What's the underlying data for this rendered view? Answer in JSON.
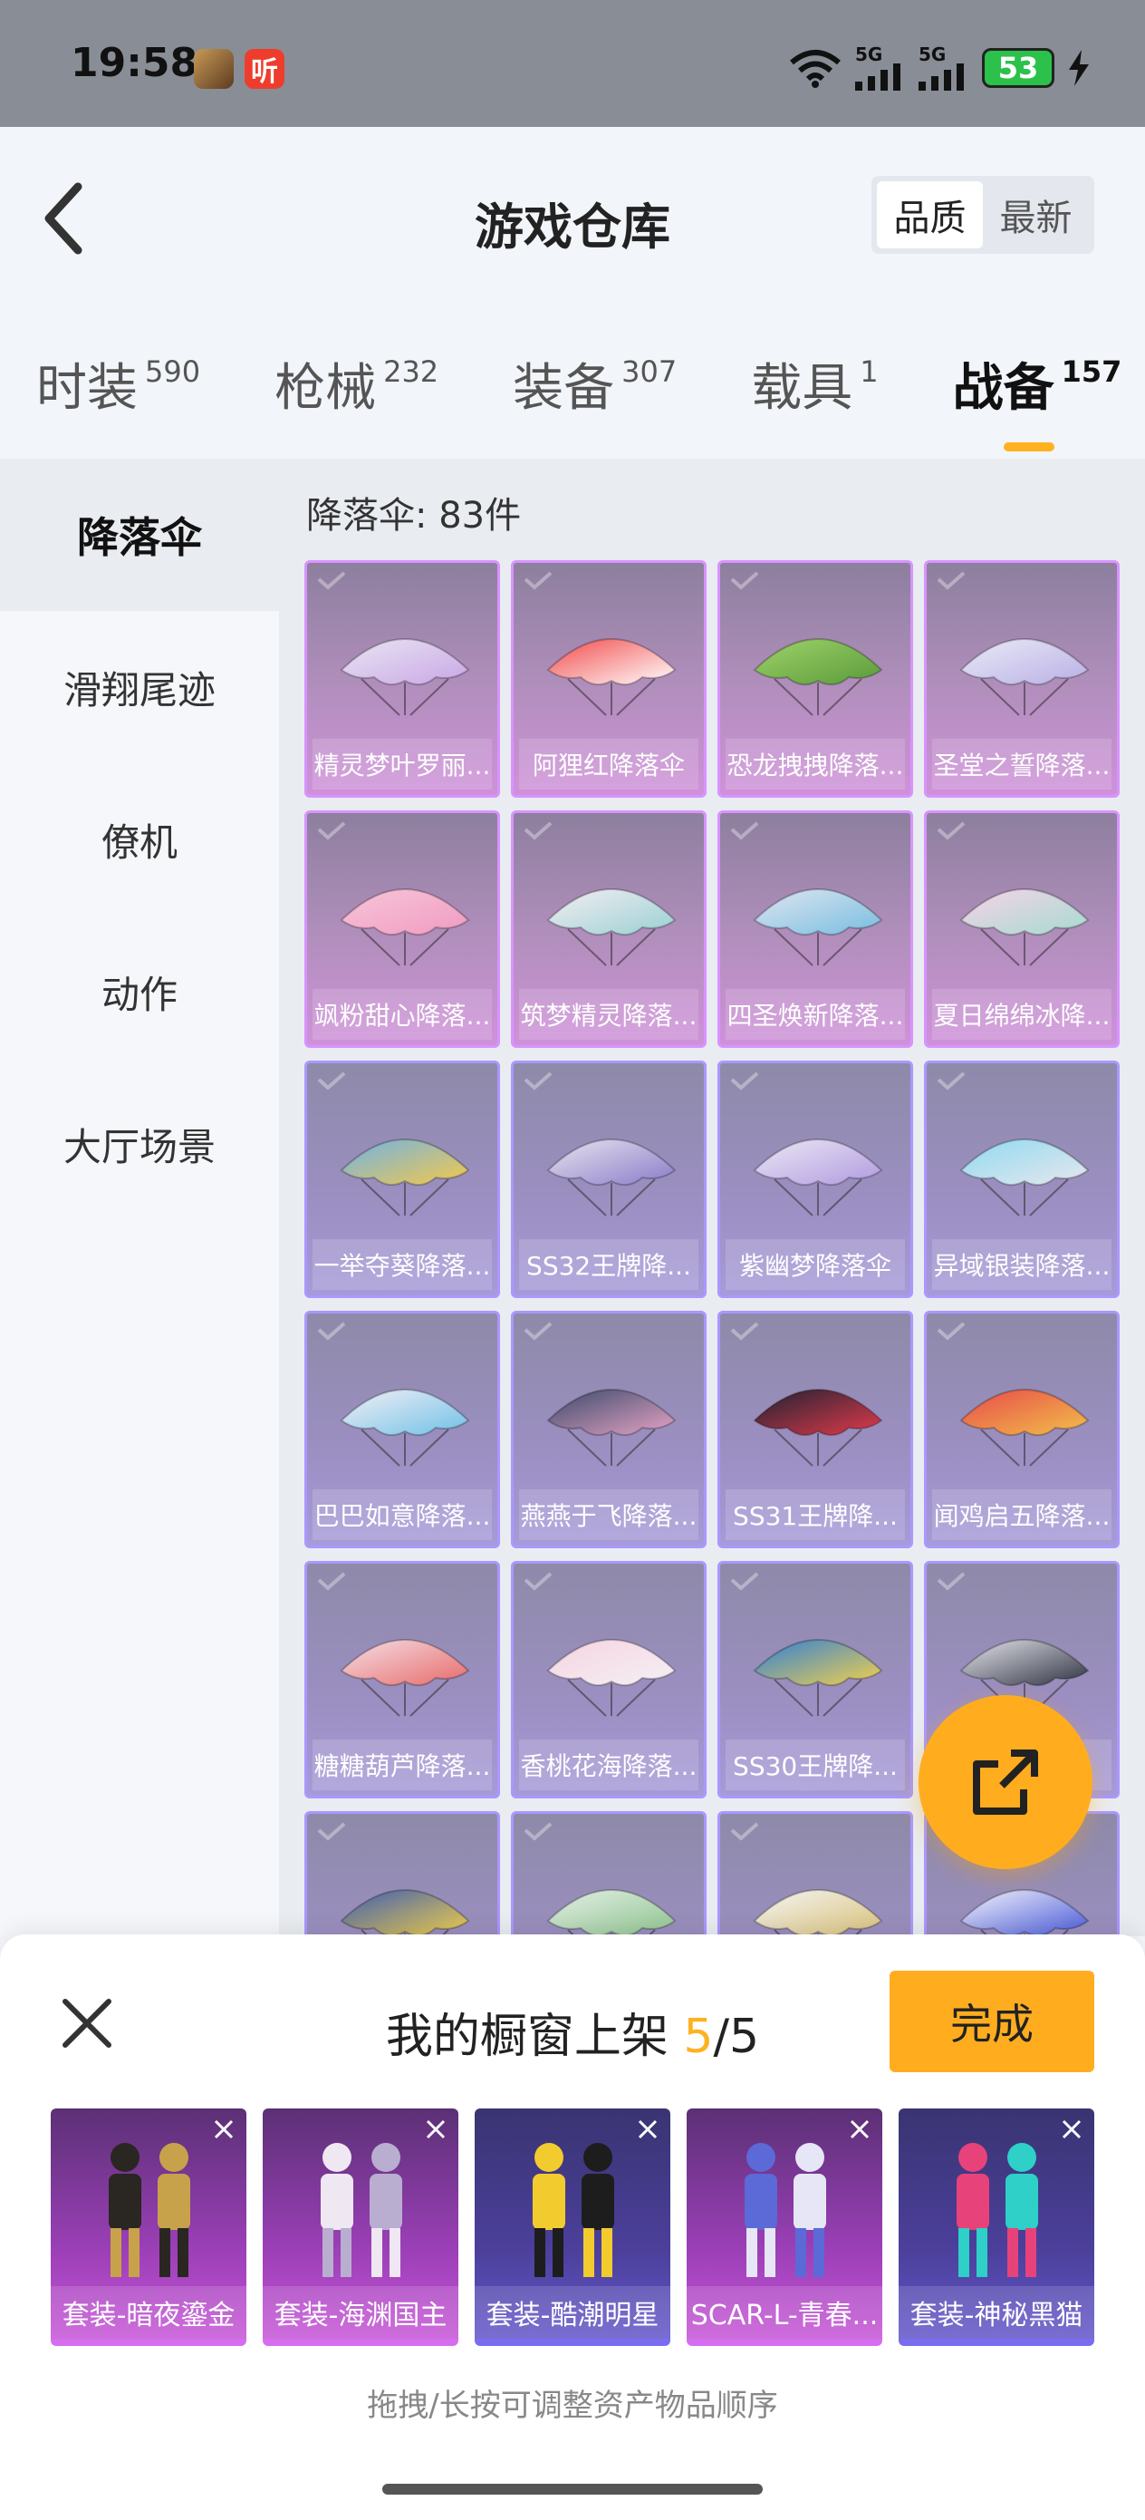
{
  "status": {
    "time": "19:58",
    "ting": "听",
    "network1": "5G",
    "network2": "5G",
    "battery": "53"
  },
  "header": {
    "title": "游戏仓库",
    "sort": [
      "品质",
      "最新"
    ]
  },
  "categories": [
    {
      "label": "时装",
      "count": "590"
    },
    {
      "label": "枪械",
      "count": "232"
    },
    {
      "label": "装备",
      "count": "307"
    },
    {
      "label": "载具",
      "count": "1"
    },
    {
      "label": "战备",
      "count": "157"
    }
  ],
  "sidebar": [
    "降落伞",
    "滑翔尾迹",
    "僚机",
    "动作",
    "大厅场景"
  ],
  "main": {
    "count_label": "降落伞: 83件",
    "items": [
      {
        "name": "精灵梦叶罗丽...",
        "rarity": "purple",
        "colors": [
          "#e9e5f2",
          "#c9a7e6"
        ]
      },
      {
        "name": "阿狸红降落伞",
        "rarity": "purple",
        "colors": [
          "#f24b4b",
          "#ffffff"
        ]
      },
      {
        "name": "恐龙拽拽降落...",
        "rarity": "purple",
        "colors": [
          "#9fd36a",
          "#5a9a3a"
        ]
      },
      {
        "name": "圣堂之誓降落...",
        "rarity": "purple",
        "colors": [
          "#eaeaf6",
          "#b9b0e6"
        ]
      },
      {
        "name": "飒粉甜心降落...",
        "rarity": "purple",
        "colors": [
          "#f7c6d9",
          "#f09bc1"
        ]
      },
      {
        "name": "筑梦精灵降落...",
        "rarity": "purple",
        "colors": [
          "#f4eef2",
          "#9ad0d4"
        ]
      },
      {
        "name": "四圣焕新降落...",
        "rarity": "purple",
        "colors": [
          "#dfe6f0",
          "#78bde0"
        ]
      },
      {
        "name": "夏日绵绵冰降...",
        "rarity": "purple",
        "colors": [
          "#f7d3e8",
          "#a6dbd0"
        ]
      },
      {
        "name": "一举夺葵降落...",
        "rarity": "blue",
        "colors": [
          "#6fb3e8",
          "#f4c84a"
        ]
      },
      {
        "name": "SS32王牌降...",
        "rarity": "blue",
        "colors": [
          "#e8e4ee",
          "#8a7bc9"
        ]
      },
      {
        "name": "紫幽梦降落伞",
        "rarity": "blue",
        "colors": [
          "#ece8f4",
          "#b09ae0"
        ]
      },
      {
        "name": "异域银装降落...",
        "rarity": "blue",
        "colors": [
          "#8fdaf0",
          "#e7e7ee"
        ]
      },
      {
        "name": "巴巴如意降落...",
        "rarity": "blue",
        "colors": [
          "#f4f0f4",
          "#6fc0e8"
        ]
      },
      {
        "name": "燕燕于飞降落...",
        "rarity": "blue",
        "colors": [
          "#3a4a6a",
          "#e6a3c6"
        ]
      },
      {
        "name": "SS31王牌降...",
        "rarity": "blue",
        "colors": [
          "#1e2233",
          "#e23a4a"
        ]
      },
      {
        "name": "闻鸡启五降落...",
        "rarity": "blue",
        "colors": [
          "#e84a4a",
          "#f2c04a"
        ]
      },
      {
        "name": "糖糖葫芦降落...",
        "rarity": "blue",
        "colors": [
          "#f4e0e6",
          "#e86a6a"
        ]
      },
      {
        "name": "香桃花海降落...",
        "rarity": "blue",
        "colors": [
          "#f6d4e2",
          "#f4f0f4"
        ]
      },
      {
        "name": "SS30王牌降...",
        "rarity": "blue",
        "colors": [
          "#2f7fd9",
          "#f4d14a"
        ]
      },
      {
        "name": "",
        "rarity": "blue",
        "colors": [
          "#e6e6ee",
          "#2e3240"
        ]
      },
      {
        "name": "",
        "rarity": "blue",
        "colors": [
          "#3b5bb3",
          "#f4d14a"
        ]
      },
      {
        "name": "",
        "rarity": "blue",
        "colors": [
          "#e4efe6",
          "#8fc48f"
        ]
      },
      {
        "name": "",
        "rarity": "blue",
        "colors": [
          "#f4f4f4",
          "#d9c27a"
        ]
      },
      {
        "name": "",
        "rarity": "blue",
        "colors": [
          "#f4f4fb",
          "#4a5bd9"
        ]
      }
    ]
  },
  "sheet": {
    "title_prefix": "我的橱窗上架 ",
    "current": "5",
    "separator": "/",
    "max": "5",
    "done_label": "完成",
    "hint": "拖拽/长按可调整资产物品顺序",
    "slots": [
      {
        "label": "套装-暗夜鎏金",
        "rarity": "purple",
        "colors": [
          "#2a2622",
          "#c8a24a"
        ]
      },
      {
        "label": "套装-海渊国主",
        "rarity": "purple",
        "colors": [
          "#efe7f2",
          "#b9aed0"
        ]
      },
      {
        "label": "套装-酷潮明星",
        "rarity": "blue",
        "colors": [
          "#f2cc2e",
          "#1d1d1d"
        ]
      },
      {
        "label": "SCAR-L-青春...",
        "rarity": "purple",
        "colors": [
          "#5b6ad6",
          "#e6e6f6"
        ]
      },
      {
        "label": "套装-神秘黑猫",
        "rarity": "blue",
        "colors": [
          "#e8427a",
          "#2ed0c8"
        ]
      }
    ]
  },
  "colors": {
    "accent": "#ffad1f",
    "purple_rarity": "#d893ff",
    "blue_rarity": "#aa97ff"
  }
}
